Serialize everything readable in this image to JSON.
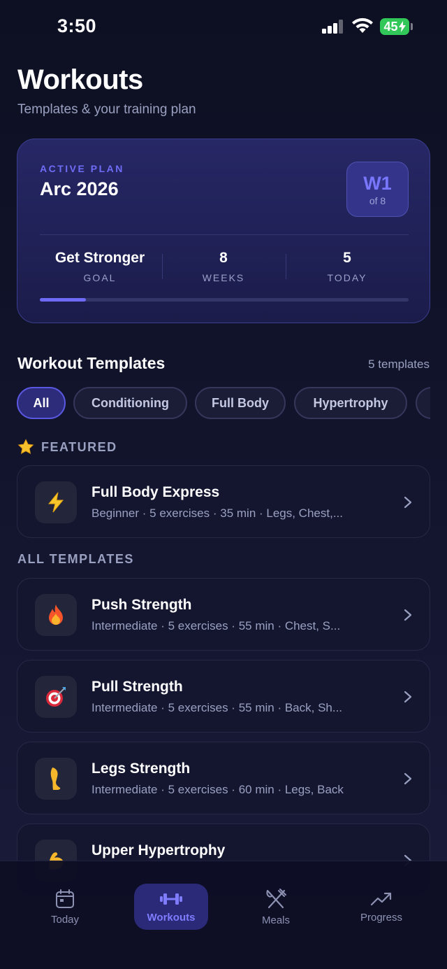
{
  "status_bar": {
    "time": "3:50",
    "battery": "45"
  },
  "header": {
    "title": "Workouts",
    "subtitle": "Templates & your training plan"
  },
  "plan": {
    "eyebrow": "ACTIVE PLAN",
    "name": "Arc 2026",
    "week_badge": "W1",
    "week_of": "of 8",
    "stats": [
      {
        "value": "Get Stronger",
        "label": "GOAL"
      },
      {
        "value": "8",
        "label": "WEEKS"
      },
      {
        "value": "5",
        "label": "TODAY"
      }
    ],
    "progress_fraction": 0.125,
    "accent": "#6e6af6"
  },
  "templates_section": {
    "title": "Workout Templates",
    "count": "5 templates"
  },
  "filters": [
    "All",
    "Conditioning",
    "Full Body",
    "Hypertrophy",
    ""
  ],
  "featured": {
    "label": "FEATURED",
    "icon": "star-icon",
    "items": [
      {
        "name": "Full Body Express",
        "meta": "Beginner · 5 exercises · 35 min  ·  Legs, Chest,...",
        "icon": "lightning-icon"
      }
    ]
  },
  "all_templates": {
    "label": "ALL TEMPLATES",
    "items": [
      {
        "name": "Push Strength",
        "meta": "Intermediate · 5 exercises · 55 min  ·  Chest, S...",
        "icon": "fire-icon"
      },
      {
        "name": "Pull Strength",
        "meta": "Intermediate · 5 exercises · 55 min  ·  Back, Sh...",
        "icon": "target-icon"
      },
      {
        "name": "Legs Strength",
        "meta": "Intermediate · 5 exercises · 60 min  ·  Legs, Back",
        "icon": "leg-icon"
      },
      {
        "name": "Upper Hypertrophy",
        "meta": "",
        "icon": "flexed-arm-icon"
      }
    ]
  },
  "tabbar": [
    {
      "label": "Today",
      "icon": "calendar-icon",
      "active": false
    },
    {
      "label": "Workouts",
      "icon": "dumbbell-icon",
      "active": true
    },
    {
      "label": "Meals",
      "icon": "fork-knife-icon",
      "active": false
    },
    {
      "label": "Progress",
      "icon": "trend-icon",
      "active": false
    }
  ]
}
